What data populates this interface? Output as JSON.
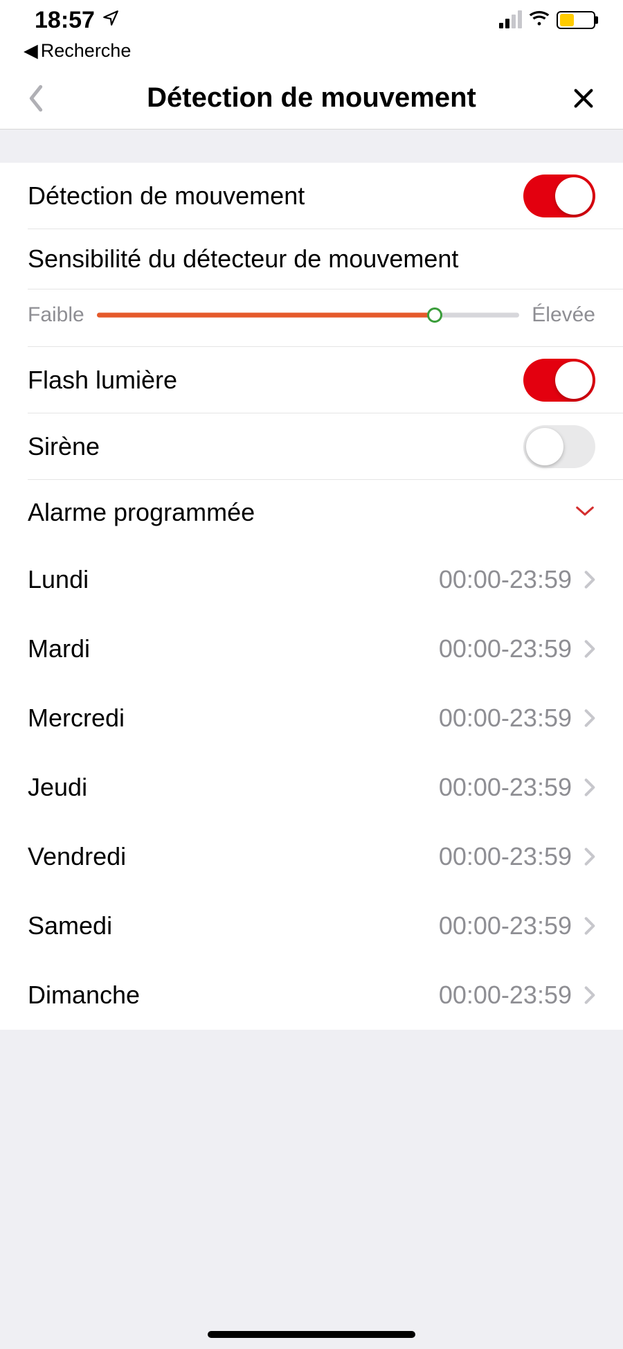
{
  "status": {
    "time": "18:57",
    "back_app": "Recherche"
  },
  "nav": {
    "title": "Détection de mouvement"
  },
  "rows": {
    "motion_detect_label": "Détection de mouvement",
    "motion_detect_on": true,
    "sensitivity_label": "Sensibilité du détecteur de mouvement",
    "sensitivity_low": "Faible",
    "sensitivity_high": "Élevée",
    "sensitivity_pct": 80,
    "flash_label": "Flash lumière",
    "flash_on": true,
    "siren_label": "Sirène",
    "siren_on": false,
    "schedule_title": "Alarme programmée"
  },
  "schedule": [
    {
      "day": "Lundi",
      "range": "00:00-23:59"
    },
    {
      "day": "Mardi",
      "range": "00:00-23:59"
    },
    {
      "day": "Mercredi",
      "range": "00:00-23:59"
    },
    {
      "day": "Jeudi",
      "range": "00:00-23:59"
    },
    {
      "day": "Vendredi",
      "range": "00:00-23:59"
    },
    {
      "day": "Samedi",
      "range": "00:00-23:59"
    },
    {
      "day": "Dimanche",
      "range": "00:00-23:59"
    }
  ]
}
